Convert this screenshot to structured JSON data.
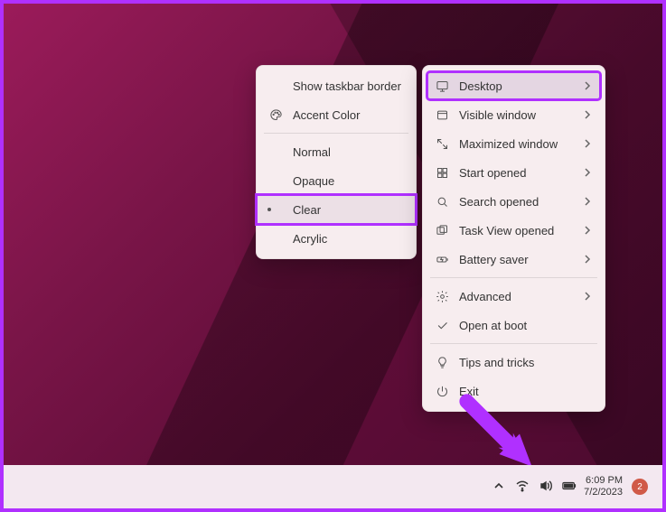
{
  "left_menu": {
    "show_border": "Show taskbar border",
    "accent_color": "Accent Color",
    "normal": "Normal",
    "opaque": "Opaque",
    "clear": "Clear",
    "acrylic": "Acrylic"
  },
  "right_menu": {
    "desktop": "Desktop",
    "visible_window": "Visible window",
    "maximized_window": "Maximized window",
    "start_opened": "Start opened",
    "search_opened": "Search opened",
    "taskview_opened": "Task View opened",
    "battery_saver": "Battery saver",
    "advanced": "Advanced",
    "open_at_boot": "Open at boot",
    "tips": "Tips and tricks",
    "exit": "Exit"
  },
  "taskbar": {
    "time": "6:09 PM",
    "date": "7/2/2023",
    "notif_count": "2"
  }
}
